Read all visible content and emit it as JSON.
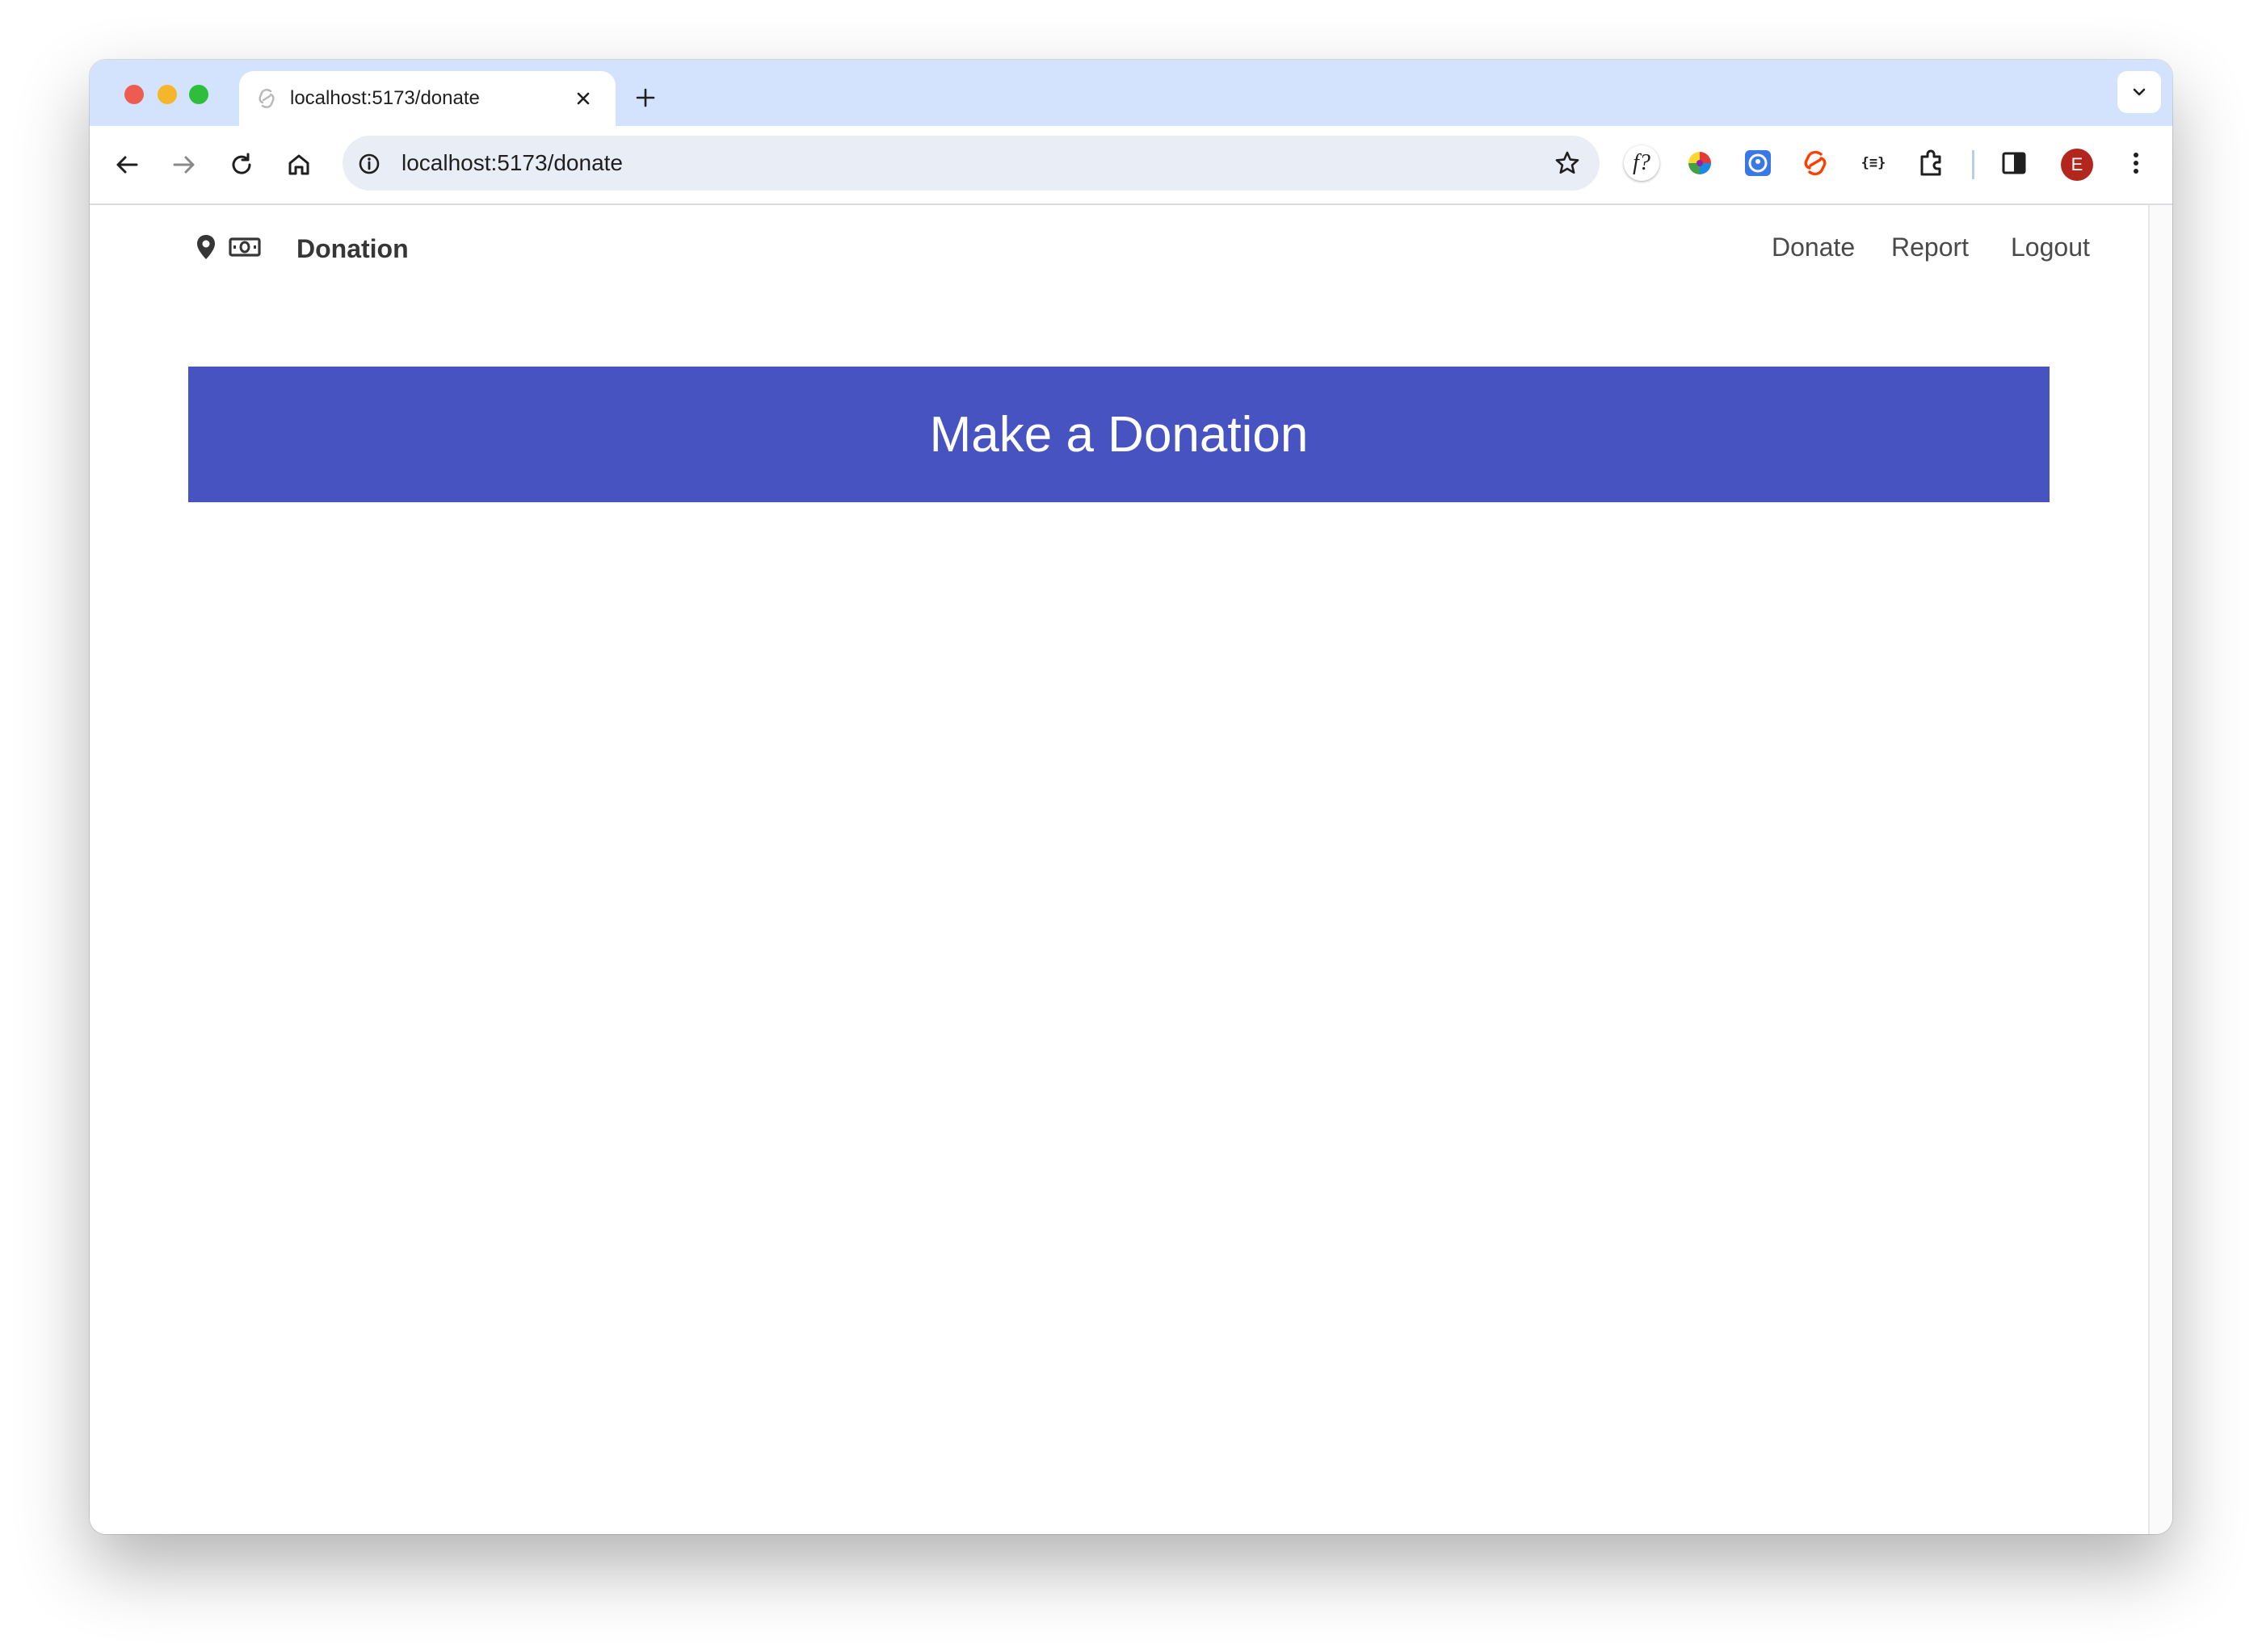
{
  "browser": {
    "tab_title": "localhost:5173/donate",
    "url": "localhost:5173/donate",
    "profile_initial": "E",
    "extension_f_label": "f?",
    "extension_json_label": "{≡}"
  },
  "navbar": {
    "brand": "Donation",
    "links": [
      "Donate",
      "Report",
      "Logout"
    ]
  },
  "hero": {
    "title": "Make a Donation"
  },
  "colors": {
    "hero_bg": "#4653c1",
    "tabstrip_bg": "#d3e3fd",
    "avatar_bg": "#b3261e"
  }
}
